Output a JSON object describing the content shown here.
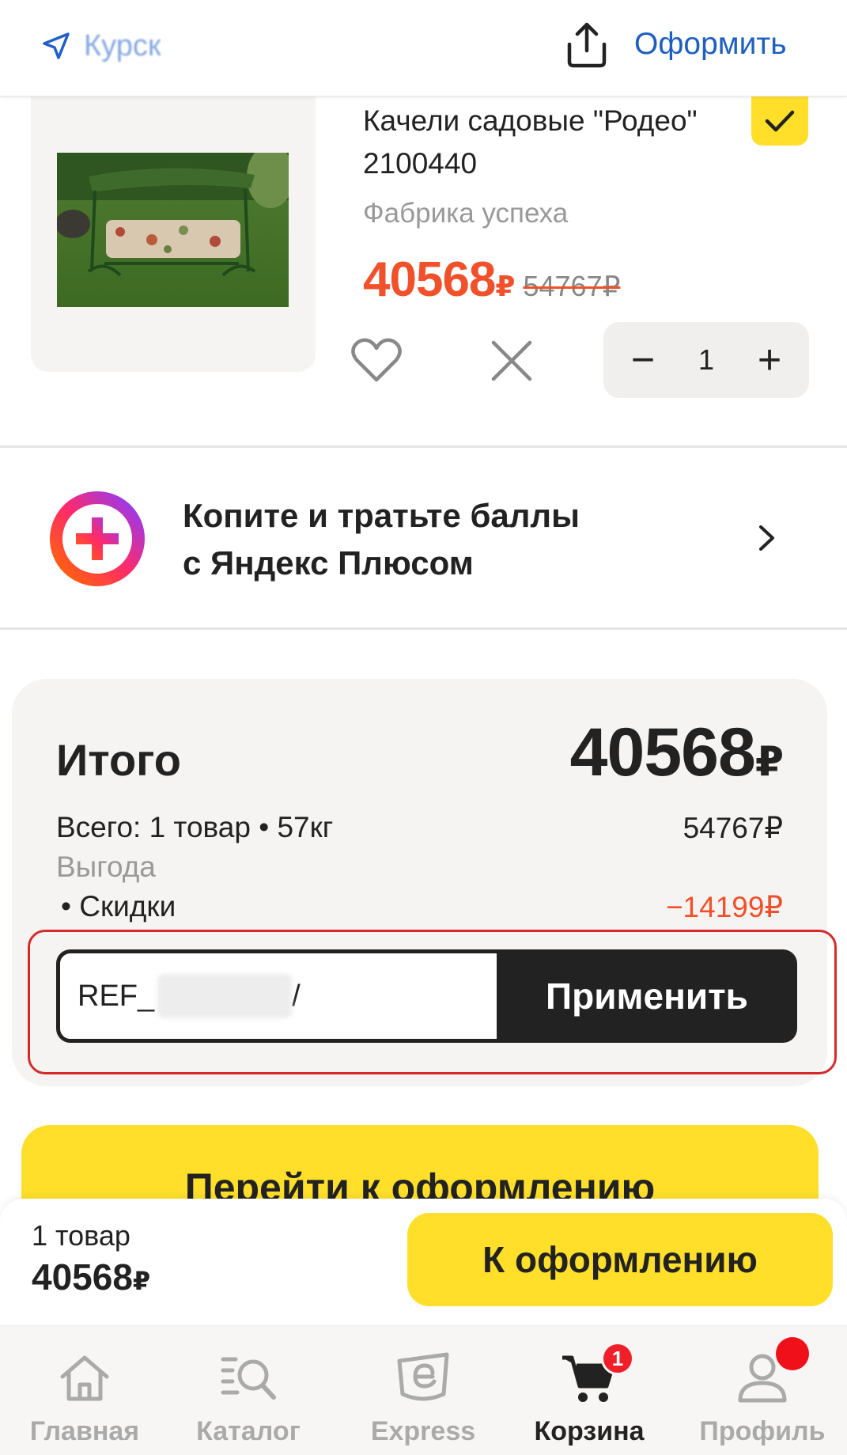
{
  "header": {
    "location": "Курск",
    "checkout_link": "Оформить"
  },
  "product": {
    "title": "Качели садовые \"Родео\" 2100440",
    "brand": "Фабрика успеха",
    "price": "40568",
    "price_currency": "₽",
    "old_price": "54767₽",
    "quantity": "1",
    "selected": true,
    "qty_minus": "−",
    "qty_plus": "+"
  },
  "plus_promo": {
    "line1": "Копите и тратьте баллы",
    "line2": "с Яндекс Плюсом"
  },
  "summary": {
    "title": "Итого",
    "total": "40568",
    "total_currency": "₽",
    "items_label": "Всего: 1 товар • 57кг",
    "items_value": "54767₽",
    "benefit_label": "Выгода",
    "discount_label": "• Скидки",
    "discount_value": "−14199₽",
    "promo_prefix": "REF_",
    "promo_suffix": "/",
    "apply_button": "Применить"
  },
  "go_checkout_button": "Перейти к оформлению",
  "sticky": {
    "count": "1 товар",
    "price": "40568",
    "currency": "₽",
    "button": "К оформлению"
  },
  "tabs": [
    {
      "label": "Главная",
      "icon": "home-icon"
    },
    {
      "label": "Каталог",
      "icon": "catalog-search-icon"
    },
    {
      "label": "Express",
      "icon": "express-icon"
    },
    {
      "label": "Корзина",
      "icon": "cart-icon",
      "badge": "1",
      "active": true
    },
    {
      "label": "Профиль",
      "icon": "profile-icon"
    }
  ],
  "colors": {
    "accent_yellow": "#ffdf2a",
    "price_red": "#f0502a",
    "link_blue": "#1f5fc0",
    "highlight_red": "#d62a2a"
  }
}
